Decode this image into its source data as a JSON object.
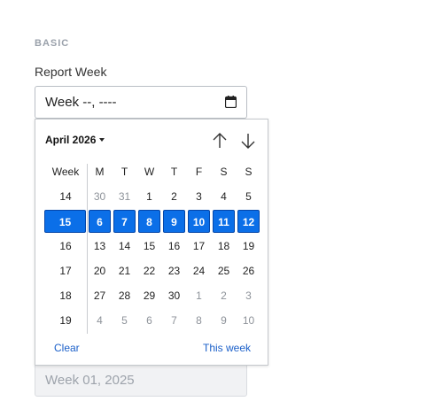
{
  "section": {
    "label": "BASIC"
  },
  "field": {
    "label": "Report Week",
    "value": "Week --, ----"
  },
  "picker": {
    "month_label": "April 2026",
    "week_header": "Week",
    "day_headers": [
      "M",
      "T",
      "W",
      "T",
      "F",
      "S",
      "S"
    ],
    "weeks": [
      {
        "week": "14",
        "days": [
          "30",
          "31",
          "1",
          "2",
          "3",
          "4",
          "5"
        ],
        "other_month": [
          true,
          true,
          false,
          false,
          false,
          false,
          false
        ],
        "selected": false
      },
      {
        "week": "15",
        "days": [
          "6",
          "7",
          "8",
          "9",
          "10",
          "11",
          "12"
        ],
        "other_month": [
          false,
          false,
          false,
          false,
          false,
          false,
          false
        ],
        "selected": true
      },
      {
        "week": "16",
        "days": [
          "13",
          "14",
          "15",
          "16",
          "17",
          "18",
          "19"
        ],
        "other_month": [
          false,
          false,
          false,
          false,
          false,
          false,
          false
        ],
        "selected": false
      },
      {
        "week": "17",
        "days": [
          "20",
          "21",
          "22",
          "23",
          "24",
          "25",
          "26"
        ],
        "other_month": [
          false,
          false,
          false,
          false,
          false,
          false,
          false
        ],
        "selected": false
      },
      {
        "week": "18",
        "days": [
          "27",
          "28",
          "29",
          "30",
          "1",
          "2",
          "3"
        ],
        "other_month": [
          false,
          false,
          false,
          false,
          true,
          true,
          true
        ],
        "selected": false
      },
      {
        "week": "19",
        "days": [
          "4",
          "5",
          "6",
          "7",
          "8",
          "9",
          "10"
        ],
        "other_month": [
          true,
          true,
          true,
          true,
          true,
          true,
          true
        ],
        "selected": false
      }
    ],
    "clear_label": "Clear",
    "this_week_label": "This week"
  },
  "disabled_field": {
    "value": "Week 01, 2025"
  },
  "colors": {
    "accent": "#0b6fe8",
    "link": "#1a5fc9",
    "muted_label": "#9aa1ab"
  },
  "icons": {
    "calendar": "calendar-icon",
    "prev": "arrow-up-icon",
    "next": "arrow-down-icon"
  }
}
